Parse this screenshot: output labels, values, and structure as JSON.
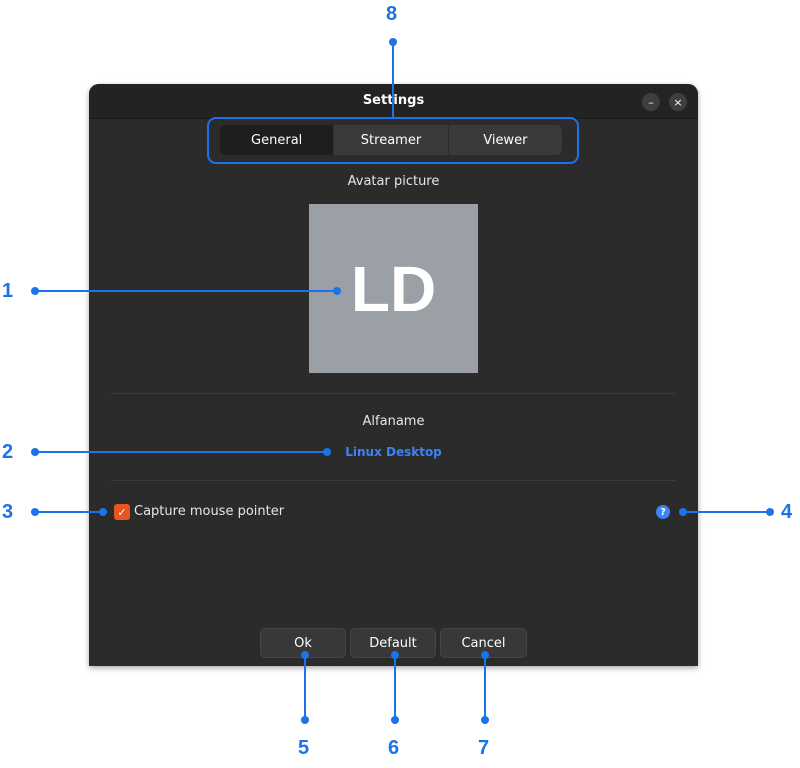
{
  "window": {
    "title": "Settings",
    "minimize_glyph": "–",
    "close_glyph": "×"
  },
  "tabs": [
    {
      "label": "General",
      "active": true
    },
    {
      "label": "Streamer",
      "active": false
    },
    {
      "label": "Viewer",
      "active": false
    }
  ],
  "avatar": {
    "label": "Avatar picture",
    "initials": "LD",
    "background": "#9aa0a6"
  },
  "alfaname": {
    "label": "Alfaname",
    "value": "Linux Desktop"
  },
  "capture_mouse": {
    "label": "Capture mouse pointer",
    "checked": true,
    "check_glyph": "✓"
  },
  "help_icon": {
    "glyph": "?"
  },
  "buttons": {
    "ok": "Ok",
    "default": "Default",
    "cancel": "Cancel"
  },
  "annotations": [
    "1",
    "2",
    "3",
    "4",
    "5",
    "6",
    "7",
    "8"
  ],
  "colors": {
    "accent": "#e95420",
    "link": "#3b83f7",
    "annotation": "#1a73e8"
  }
}
